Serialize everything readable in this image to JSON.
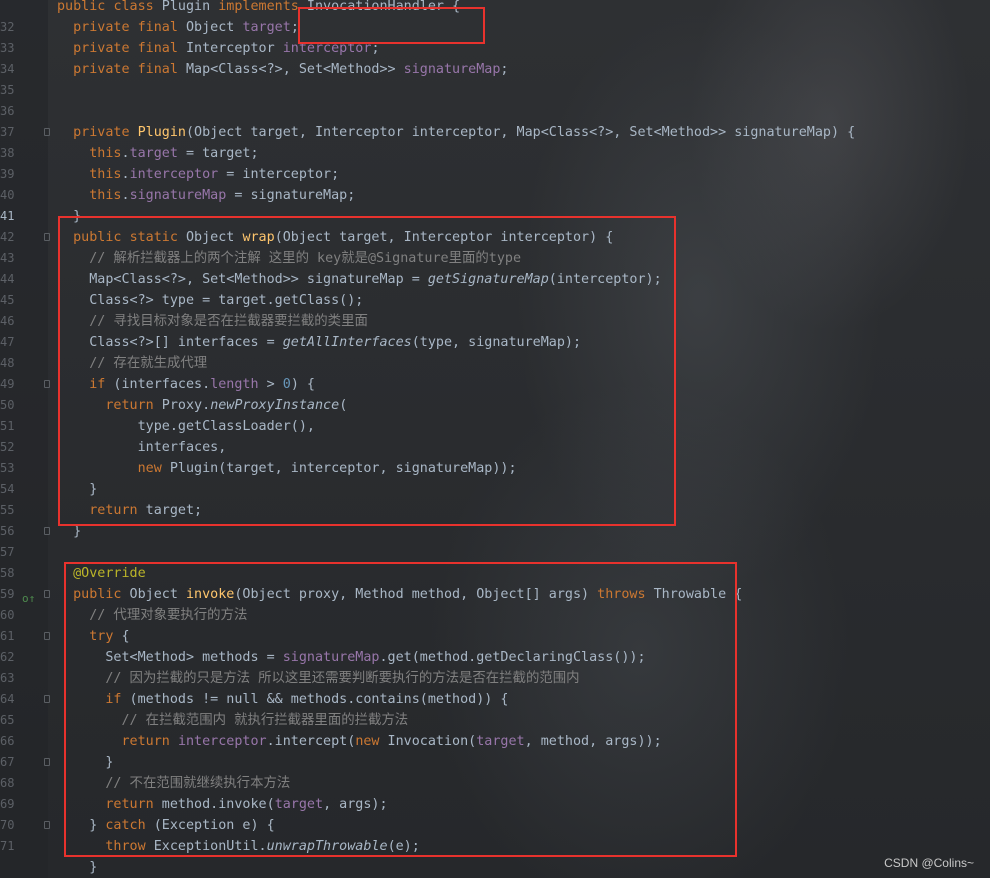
{
  "lines": [
    {
      "n": "",
      "text": "public class Plugin implements InvocationHandler {"
    },
    {
      "n": "32",
      "text": "  private final Object target;"
    },
    {
      "n": "33",
      "text": "  private final Interceptor interceptor;"
    },
    {
      "n": "34",
      "text": "  private final Map<Class<?>, Set<Method>> signatureMap;"
    },
    {
      "n": "35",
      "text": ""
    },
    {
      "n": "36",
      "text": ""
    },
    {
      "n": "37",
      "text": "  private Plugin(Object target, Interceptor interceptor, Map<Class<?>, Set<Method>> signatureMap) {"
    },
    {
      "n": "38",
      "text": "    this.target = target;"
    },
    {
      "n": "39",
      "text": "    this.interceptor = interceptor;"
    },
    {
      "n": "40",
      "text": "    this.signatureMap = signatureMap;"
    },
    {
      "n": "41",
      "text": "  }"
    },
    {
      "n": "42",
      "text": "  public static Object wrap(Object target, Interceptor interceptor) {"
    },
    {
      "n": "43",
      "text": "    // 解析拦截器上的两个注解 这里的 key就是@Signature里面的type"
    },
    {
      "n": "44",
      "text": "    Map<Class<?>, Set<Method>> signatureMap = getSignatureMap(interceptor);"
    },
    {
      "n": "45",
      "text": "    Class<?> type = target.getClass();"
    },
    {
      "n": "46",
      "text": "    // 寻找目标对象是否在拦截器要拦截的类里面"
    },
    {
      "n": "47",
      "text": "    Class<?>[] interfaces = getAllInterfaces(type, signatureMap);"
    },
    {
      "n": "48",
      "text": "    // 存在就生成代理"
    },
    {
      "n": "49",
      "text": "    if (interfaces.length > 0) {"
    },
    {
      "n": "50",
      "text": "      return Proxy.newProxyInstance("
    },
    {
      "n": "51",
      "text": "          type.getClassLoader(),"
    },
    {
      "n": "52",
      "text": "          interfaces,"
    },
    {
      "n": "53",
      "text": "          new Plugin(target, interceptor, signatureMap));"
    },
    {
      "n": "54",
      "text": "    }"
    },
    {
      "n": "55",
      "text": "    return target;"
    },
    {
      "n": "56",
      "text": "  }"
    },
    {
      "n": "57",
      "text": ""
    },
    {
      "n": "58",
      "text": "  @Override"
    },
    {
      "n": "59",
      "text": "  public Object invoke(Object proxy, Method method, Object[] args) throws Throwable {"
    },
    {
      "n": "60",
      "text": "    // 代理对象要执行的方法"
    },
    {
      "n": "61",
      "text": "    try {"
    },
    {
      "n": "62",
      "text": "      Set<Method> methods = signatureMap.get(method.getDeclaringClass());"
    },
    {
      "n": "63",
      "text": "      // 因为拦截的只是方法 所以这里还需要判断要执行的方法是否在拦截的范围内"
    },
    {
      "n": "64",
      "text": "      if (methods != null && methods.contains(method)) {"
    },
    {
      "n": "65",
      "text": "        // 在拦截范围内 就执行拦截器里面的拦截方法"
    },
    {
      "n": "66",
      "text": "        return interceptor.intercept(new Invocation(target, method, args));"
    },
    {
      "n": "67",
      "text": "      }"
    },
    {
      "n": "68",
      "text": "      // 不在范围就继续执行本方法"
    },
    {
      "n": "69",
      "text": "      return method.invoke(target, args);"
    },
    {
      "n": "70",
      "text": "    } catch (Exception e) {"
    },
    {
      "n": "71",
      "text": "      throw ExceptionUtil.unwrapThrowable(e);"
    },
    {
      "n": "",
      "text": "    }"
    }
  ],
  "current_line": "41",
  "watermark": "CSDN @Colins~",
  "colors": {
    "keyword": "#cc7832",
    "field": "#9876aa",
    "method": "#ffc66d",
    "comment": "#808080",
    "highlight_box": "#e8322d"
  }
}
